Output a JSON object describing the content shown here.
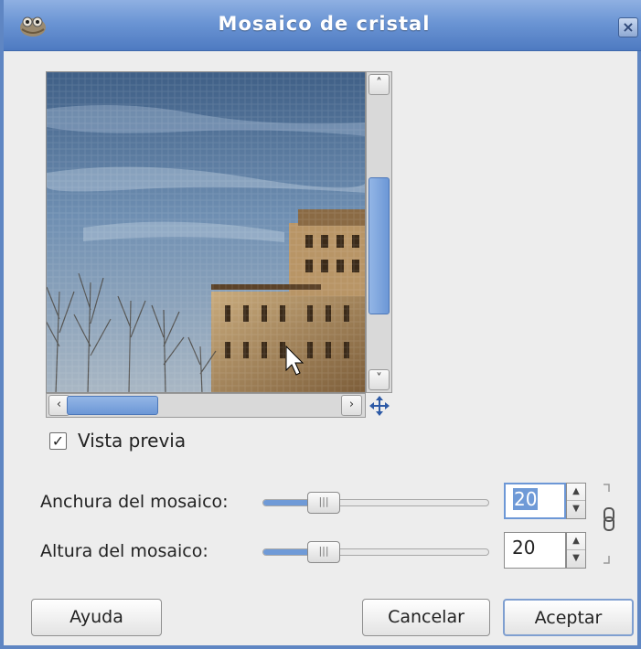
{
  "window": {
    "title": "Mosaico de cristal",
    "icon": "gimp-icon",
    "close_icon": "close-icon"
  },
  "preview": {
    "image": "glass-mosaic-building-sky",
    "toggle": {
      "label": "Vista previa",
      "checked": true
    },
    "navigate_icon": "move-arrows-icon"
  },
  "params": [
    {
      "label": "Anchura del mosaico:",
      "value": "20",
      "focused": true
    },
    {
      "label": "Altura del mosaico:",
      "value": "20",
      "focused": false
    }
  ],
  "buttons": {
    "help": "Ayuda",
    "cancel": "Cancelar",
    "ok": "Aceptar"
  },
  "colors": {
    "titlebar": "#6b95d4",
    "accent": "#6f9ad7",
    "background": "#ededed"
  }
}
